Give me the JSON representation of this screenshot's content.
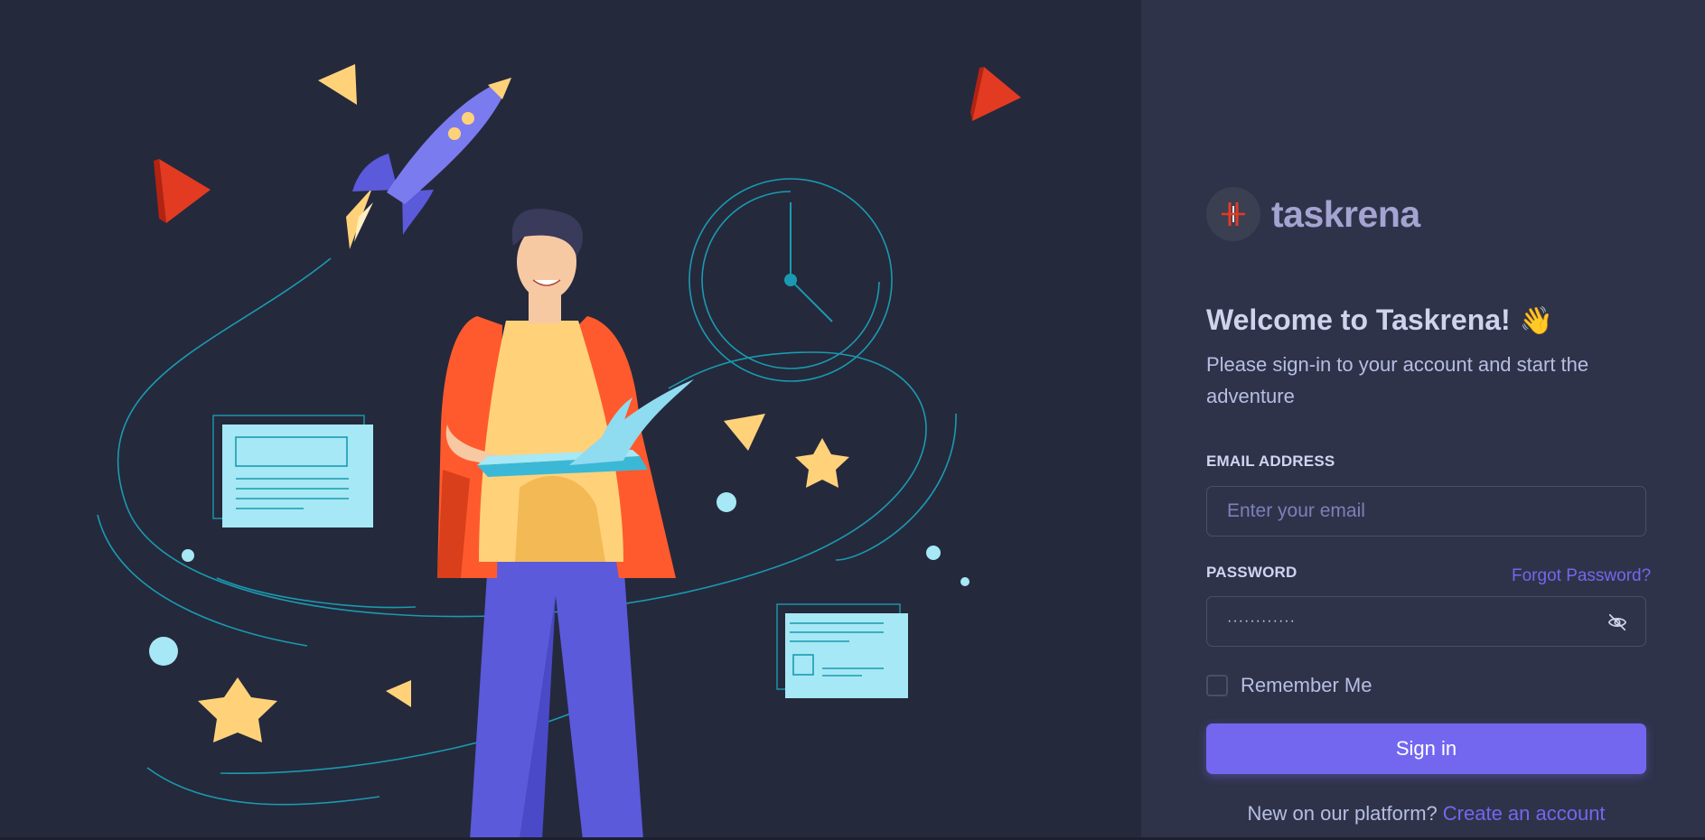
{
  "brand": {
    "name": "taskrena"
  },
  "welcome": {
    "title": "Welcome to Taskrena!",
    "emoji": "👋",
    "subtitle": "Please sign-in to your account and start the adventure"
  },
  "form": {
    "email_label": "EMAIL ADDRESS",
    "email_placeholder": "Enter your email",
    "email_value": "",
    "password_label": "PASSWORD",
    "password_value": "············",
    "forgot_label": "Forgot Password?",
    "remember_label": "Remember Me",
    "remember_checked": false,
    "signin_label": "Sign in"
  },
  "signup": {
    "prompt": "New on our platform?",
    "link": "Create an account"
  },
  "colors": {
    "primary": "#7367f0",
    "background": "#25293c",
    "panel": "#2f3349",
    "text": "#cfd3ec",
    "muted": "#b6bee3",
    "input_border": "#4a4e66"
  },
  "icons": {
    "eye_toggle": "eye-slash-icon"
  }
}
